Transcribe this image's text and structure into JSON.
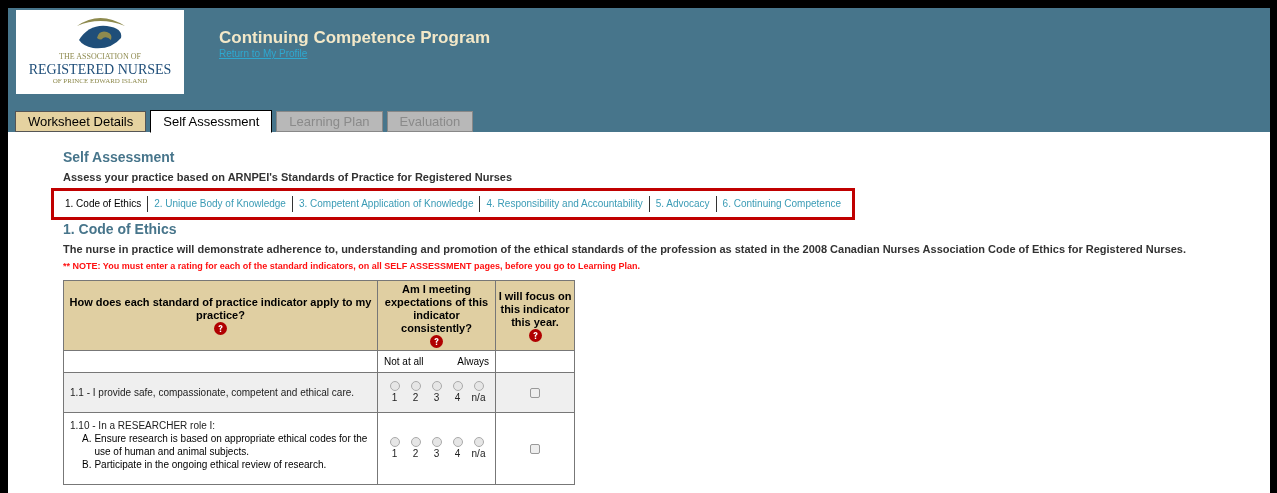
{
  "header": {
    "logo": {
      "line_1": "THE ASSOCIATION OF",
      "line_2": "REGISTERED NURSES",
      "line_3": "OF PRINCE EDWARD ISLAND"
    },
    "title": "Continuing Competence Program",
    "link": "Return to My Profile"
  },
  "tabs": [
    {
      "label": "Worksheet Details",
      "selected": false,
      "disabled": false
    },
    {
      "label": "Self Assessment",
      "selected": true,
      "disabled": false
    },
    {
      "label": "Learning Plan",
      "selected": false,
      "disabled": true
    },
    {
      "label": "Evaluation",
      "selected": false,
      "disabled": true
    }
  ],
  "page_title": "Self Assessment",
  "page_subtitle": "Assess your practice based on ARNPEI's Standards of Practice for Registered Nurses",
  "section_nav": [
    {
      "label": "1. Code of Ethics",
      "selected": true
    },
    {
      "label": "2. Unique Body of Knowledge",
      "selected": false
    },
    {
      "label": "3. Competent Application of Knowledge",
      "selected": false
    },
    {
      "label": "4. Responsibility and Accountability",
      "selected": false
    },
    {
      "label": "5. Advocacy",
      "selected": false
    },
    {
      "label": "6. Continuing Competence",
      "selected": false
    }
  ],
  "standard": {
    "title": "1. Code of Ethics",
    "text": "The nurse in practice will demonstrate adherence to, understanding and promotion of the ethical standards of the profession as stated in the 2008 Canadian Nurses Association Code of Ethics for Registered Nurses.",
    "note": "** NOTE: You must enter a rating for each of the standard indicators, on all SELF ASSESSMENT pages, before you go to Learning Plan."
  },
  "table": {
    "columns": [
      "How does each standard of practice indicator apply to my practice?",
      "Am I meeting expectations of this indicator consistently?",
      "I will focus on this indicator this year."
    ],
    "scale_labels": [
      "Not at all",
      "Always"
    ],
    "rows": [
      {
        "number": "1.1 -",
        "text": "I provide safe, compassionate, competent and ethical care.",
        "items": [],
        "options": [
          {
            "label": "1",
            "selected": false
          },
          {
            "label": "2",
            "selected": false
          },
          {
            "label": "3",
            "selected": false
          },
          {
            "label": "4",
            "selected": false
          },
          {
            "label": "n/a",
            "selected": false
          }
        ],
        "focus": false
      },
      {
        "number": "1.10 -",
        "text": "In a RESEARCHER role I:",
        "items": [
          {
            "marker": "A.",
            "text": "Ensure research is based on appropriate ethical codes for the use of human and animal subjects."
          },
          {
            "marker": "B.",
            "text": "Participate in the ongoing ethical review of research."
          }
        ],
        "options": [
          {
            "label": "1",
            "selected": false
          },
          {
            "label": "2",
            "selected": false
          },
          {
            "label": "3",
            "selected": false
          },
          {
            "label": "4",
            "selected": false
          },
          {
            "label": "n/a",
            "selected": false
          }
        ],
        "focus": false
      }
    ]
  }
}
